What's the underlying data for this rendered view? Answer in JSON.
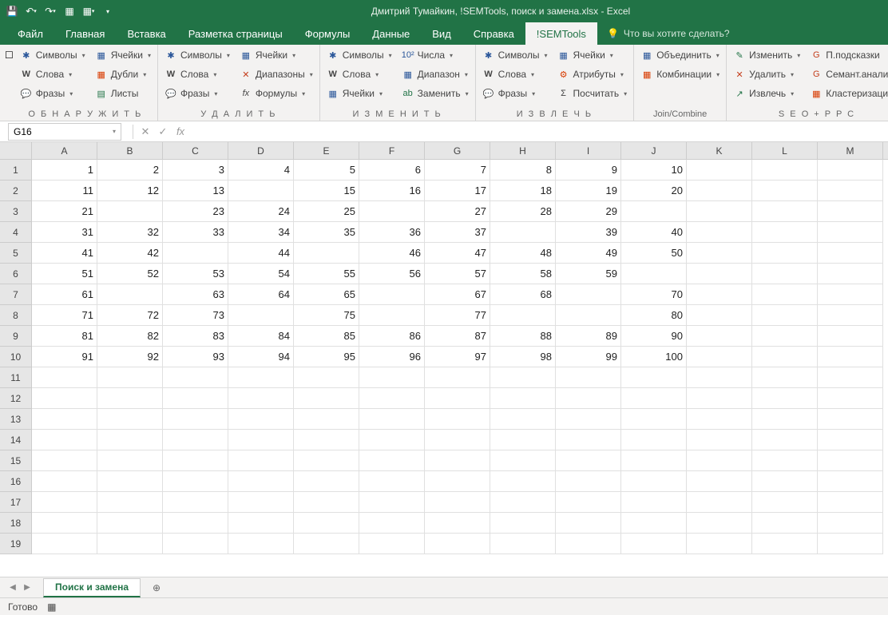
{
  "title": "Дмитрий Тумайкин, !SEMTools, поиск и замена.xlsx  -  Excel",
  "menu": {
    "file": "Файл",
    "home": "Главная",
    "insert": "Вставка",
    "layout": "Разметка страницы",
    "formulas": "Формулы",
    "data": "Данные",
    "view": "Вид",
    "help": "Справка",
    "semtools": "!SEMTools",
    "tellme": "Что вы хотите сделать?"
  },
  "ribbon": {
    "detect": {
      "label": "О Б Н А Р У Ж И Т Ь",
      "symbols": "Символы",
      "cells": "Ячейки",
      "words": "Слова",
      "dupes": "Дубли",
      "phrases": "Фразы",
      "sheets": "Листы"
    },
    "delete": {
      "label": "У Д А Л И Т Ь",
      "symbols": "Символы",
      "cells": "Ячейки",
      "words": "Слова",
      "ranges": "Диапазоны",
      "phrases": "Фразы",
      "formulas": "Формулы"
    },
    "change": {
      "label": "И З М Е Н И Т Ь",
      "symbols": "Символы",
      "numbers": "Числа",
      "words": "Слова",
      "range": "Диапазон",
      "cells": "Ячейки",
      "replace": "Заменить"
    },
    "extract": {
      "label": "И З В Л Е Ч Ь",
      "symbols": "Символы",
      "cells": "Ячейки",
      "words": "Слова",
      "attrs": "Атрибуты",
      "phrases": "Фразы",
      "count": "Посчитать"
    },
    "join": {
      "label": "Join/Combine",
      "merge": "Объединить",
      "combos": "Комбинации"
    },
    "seo": {
      "label": "S E O + P P C",
      "edit": "Изменить",
      "hints": "П.подсказки",
      "delete": "Удалить",
      "semant": "Семант.анализ",
      "extract": "Извлечь",
      "cluster": "Кластеризация"
    }
  },
  "namebox": "G16",
  "columns": [
    "A",
    "B",
    "C",
    "D",
    "E",
    "F",
    "G",
    "H",
    "I",
    "J",
    "K",
    "L",
    "M"
  ],
  "rows": [
    [
      "1",
      "2",
      "3",
      "4",
      "5",
      "6",
      "7",
      "8",
      "9",
      "10",
      "",
      "",
      ""
    ],
    [
      "11",
      "12",
      "13",
      "",
      "15",
      "16",
      "17",
      "18",
      "19",
      "20",
      "",
      "",
      ""
    ],
    [
      "21",
      "",
      "23",
      "24",
      "25",
      "",
      "27",
      "28",
      "29",
      "",
      "",
      "",
      ""
    ],
    [
      "31",
      "32",
      "33",
      "34",
      "35",
      "36",
      "37",
      "",
      "39",
      "40",
      "",
      "",
      ""
    ],
    [
      "41",
      "42",
      "",
      "44",
      "",
      "46",
      "47",
      "48",
      "49",
      "50",
      "",
      "",
      ""
    ],
    [
      "51",
      "52",
      "53",
      "54",
      "55",
      "56",
      "57",
      "58",
      "59",
      "",
      "",
      "",
      ""
    ],
    [
      "61",
      "",
      "63",
      "64",
      "65",
      "",
      "67",
      "68",
      "",
      "70",
      "",
      "",
      ""
    ],
    [
      "71",
      "72",
      "73",
      "",
      "75",
      "",
      "77",
      "",
      "",
      "80",
      "",
      "",
      ""
    ],
    [
      "81",
      "82",
      "83",
      "84",
      "85",
      "86",
      "87",
      "88",
      "89",
      "90",
      "",
      "",
      ""
    ],
    [
      "91",
      "92",
      "93",
      "94",
      "95",
      "96",
      "97",
      "98",
      "99",
      "100",
      "",
      "",
      ""
    ],
    [
      "",
      "",
      "",
      "",
      "",
      "",
      "",
      "",
      "",
      "",
      "",
      "",
      ""
    ],
    [
      "",
      "",
      "",
      "",
      "",
      "",
      "",
      "",
      "",
      "",
      "",
      "",
      ""
    ],
    [
      "",
      "",
      "",
      "",
      "",
      "",
      "",
      "",
      "",
      "",
      "",
      "",
      ""
    ],
    [
      "",
      "",
      "",
      "",
      "",
      "",
      "",
      "",
      "",
      "",
      "",
      "",
      ""
    ],
    [
      "",
      "",
      "",
      "",
      "",
      "",
      "",
      "",
      "",
      "",
      "",
      "",
      ""
    ],
    [
      "",
      "",
      "",
      "",
      "",
      "",
      "",
      "",
      "",
      "",
      "",
      "",
      ""
    ],
    [
      "",
      "",
      "",
      "",
      "",
      "",
      "",
      "",
      "",
      "",
      "",
      "",
      ""
    ],
    [
      "",
      "",
      "",
      "",
      "",
      "",
      "",
      "",
      "",
      "",
      "",
      "",
      ""
    ],
    [
      "",
      "",
      "",
      "",
      "",
      "",
      "",
      "",
      "",
      "",
      "",
      "",
      ""
    ]
  ],
  "sheet_tab": "Поиск и замена",
  "status": "Готово"
}
